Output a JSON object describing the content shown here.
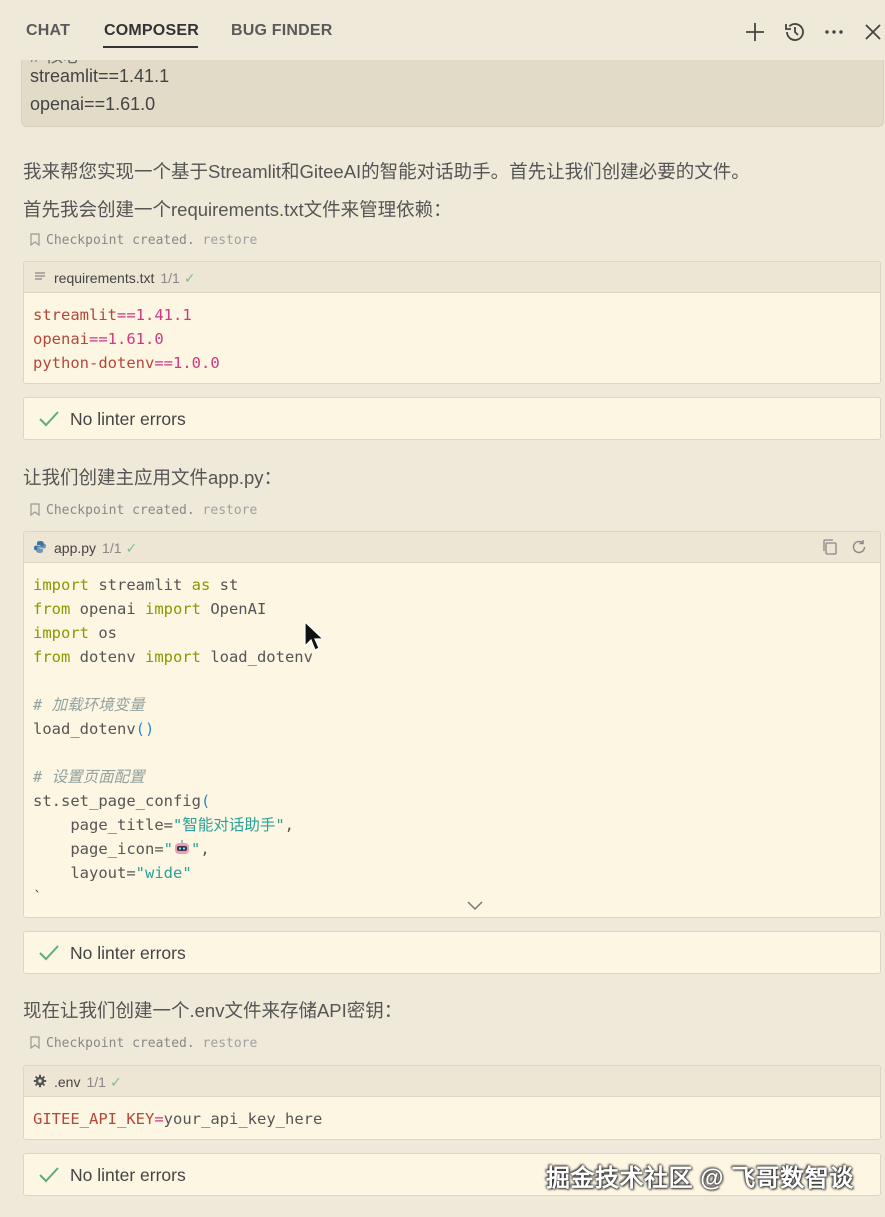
{
  "header": {
    "tabs": [
      {
        "label": "CHAT"
      },
      {
        "label": "COMPOSER",
        "active": true
      },
      {
        "label": "BUG FINDER"
      }
    ],
    "icons": [
      "plus-icon",
      "history-icon",
      "more-icon",
      "close-icon"
    ]
  },
  "prev_block": {
    "cut_text": "# 核心",
    "lines": [
      "streamlit==1.41.1",
      "openai==1.61.0"
    ]
  },
  "messages": {
    "intro1": "我来帮您实现一个基于Streamlit和GiteeAI的智能对话助手。首先让我们创建必要的文件。",
    "intro2": "首先我会创建一个requirements.txt文件来管理依赖：",
    "intro3": "让我们创建主应用文件app.py：",
    "intro4": "现在让我们创建一个.env文件来存储API密钥："
  },
  "checkpoint": {
    "text": "Checkpoint created.",
    "restore": "restore"
  },
  "files": {
    "requirements": {
      "name": "requirements.txt",
      "count": "1/1",
      "check": "✓",
      "lines": [
        {
          "name": "streamlit",
          "op": "==",
          "ver": "1.41.1"
        },
        {
          "name": "openai",
          "op": "==",
          "ver": "1.61.0"
        },
        {
          "name": "python-dotenv",
          "op": "==",
          "ver": "1.0.0"
        }
      ]
    },
    "app": {
      "name": "app.py",
      "count": "1/1",
      "check": "✓",
      "code": {
        "l1_kw": "import",
        "l1_mod": " streamlit ",
        "l1_as": "as",
        "l1_alias": " st",
        "l2_from": "from",
        "l2_mod": " openai ",
        "l2_imp": "import",
        "l2_name": " OpenAI",
        "l3_kw": "import",
        "l3_mod": " os",
        "l4_from": "from",
        "l4_mod": " dotenv ",
        "l4_imp": "import",
        "l4_name": " load_dotenv",
        "c1": "# 加载环境变量",
        "l6": "load_dotenv",
        "paren_open": "(",
        "paren_close": ")",
        "c2": "# 设置页面配置",
        "l8": "st.set_page_config",
        "arg1_key": "    page_title=",
        "arg1_val": "\"智能对话助手\"",
        "comma": ",",
        "arg2_key": "    page_icon=",
        "arg2_open": "\"",
        "arg2_close": "\"",
        "arg3_key": "    layout=",
        "arg3_val": "\"wide\"",
        "tail": "`"
      }
    },
    "env": {
      "name": ".env",
      "count": "1/1",
      "check": "✓",
      "key": "GITEE_API_KEY",
      "op": "=",
      "value": "your_api_key_here"
    }
  },
  "lint": {
    "text": "No linter errors"
  },
  "watermark": "掘金技术社区 @ 飞哥数智谈",
  "colors": {
    "background": "#efe9d9",
    "code_bg": "#fdf6e3",
    "check_green": "#7cbf8c"
  }
}
